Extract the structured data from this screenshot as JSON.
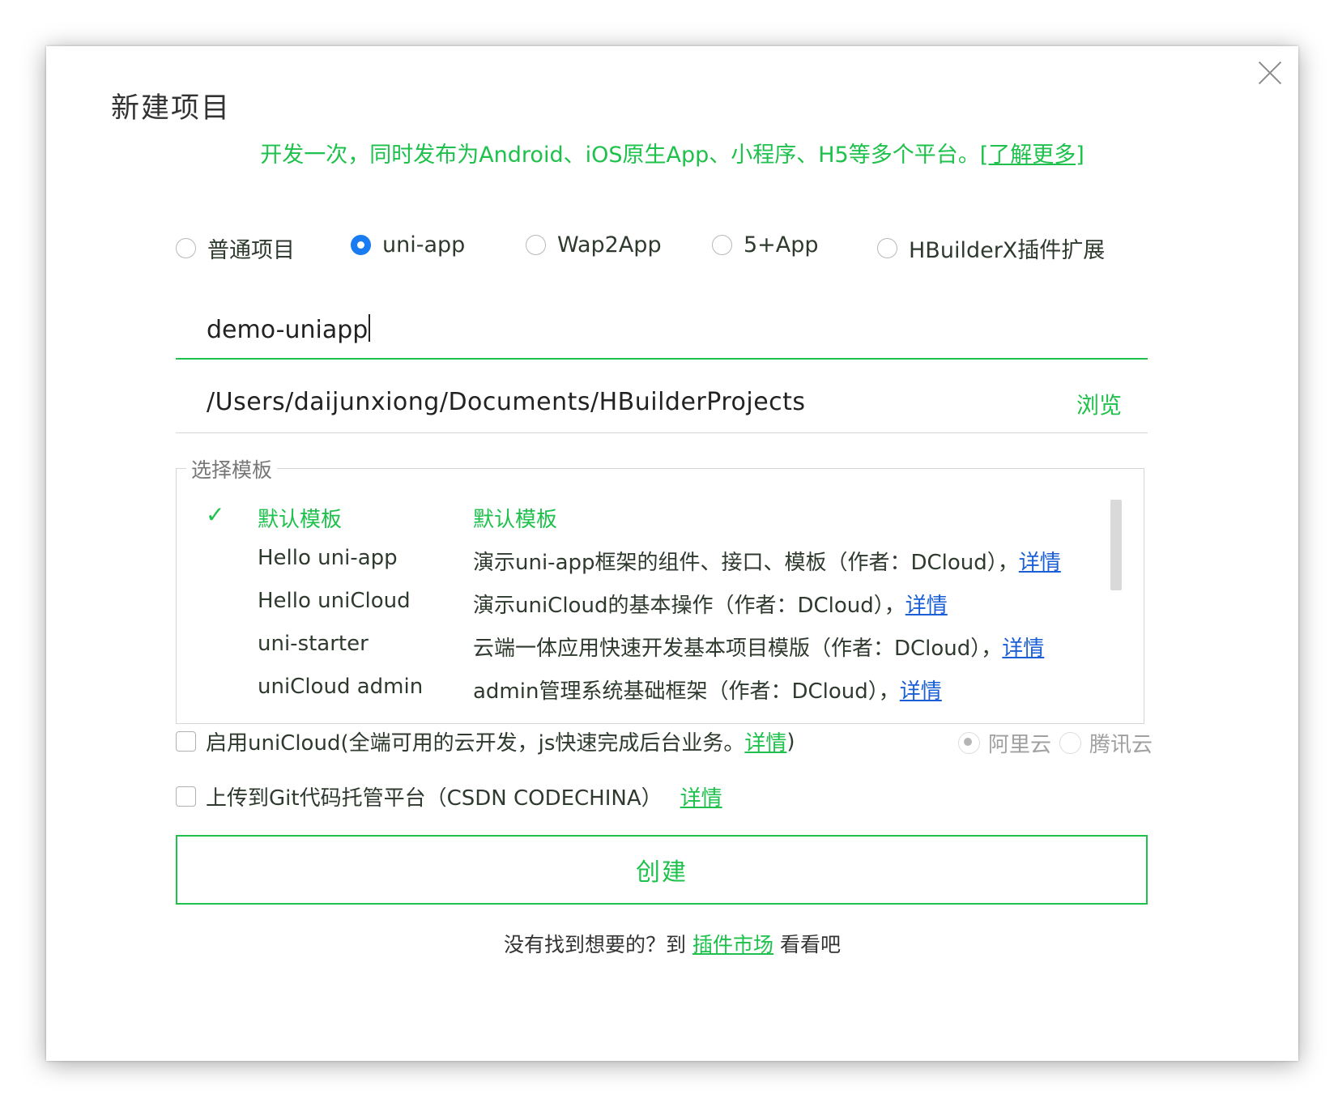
{
  "dialog": {
    "title": "新建项目",
    "subtitle_text": "开发一次，同时发布为Android、iOS原生App、小程序、H5等多个平台。",
    "subtitle_link": "[了解更多]",
    "close_icon": "close-icon"
  },
  "project_types": [
    {
      "label": "普通项目",
      "selected": false
    },
    {
      "label": "uni-app",
      "selected": true
    },
    {
      "label": "Wap2App",
      "selected": false
    },
    {
      "label": "5+App",
      "selected": false
    },
    {
      "label": "HBuilderX插件扩展",
      "selected": false
    }
  ],
  "project_name": "demo-uniapp",
  "project_path": "/Users/daijunxiong/Documents/HBuilderProjects",
  "browse_label": "浏览",
  "templates": {
    "legend": "选择模板",
    "items": [
      {
        "name": "默认模板",
        "desc": "默认模板",
        "link": "",
        "selected": true
      },
      {
        "name": "Hello uni-app",
        "desc": "演示uni-app框架的组件、接口、模板（作者：DCloud），",
        "link": "详情",
        "selected": false
      },
      {
        "name": "Hello uniCloud",
        "desc": "演示uniCloud的基本操作（作者：DCloud），",
        "link": "详情",
        "selected": false
      },
      {
        "name": "uni-starter",
        "desc": "云端一体应用快速开发基本项目模版（作者：DCloud），",
        "link": "详情",
        "selected": false
      },
      {
        "name": "uniCloud admin",
        "desc": "admin管理系统基础框架（作者：DCloud），",
        "link": "详情",
        "selected": false
      }
    ]
  },
  "unicloud": {
    "label_before": "启用uniCloud(全端可用的云开发，js快速完成后台业务。",
    "link": "详情",
    "label_after": ")",
    "providers": [
      {
        "label": "阿里云",
        "selected": true
      },
      {
        "label": "腾讯云",
        "selected": false
      }
    ]
  },
  "git": {
    "label": "上传到Git代码托管平台（CSDN CODECHINA）",
    "link": "详情"
  },
  "create_button": "创建",
  "footer": {
    "before": "没有找到想要的？到",
    "link": "插件市场",
    "after": "看看吧"
  },
  "colors": {
    "accent": "#1ec14b",
    "radio_selected": "#1a7cf0",
    "link_blue": "#1a5fd6"
  }
}
